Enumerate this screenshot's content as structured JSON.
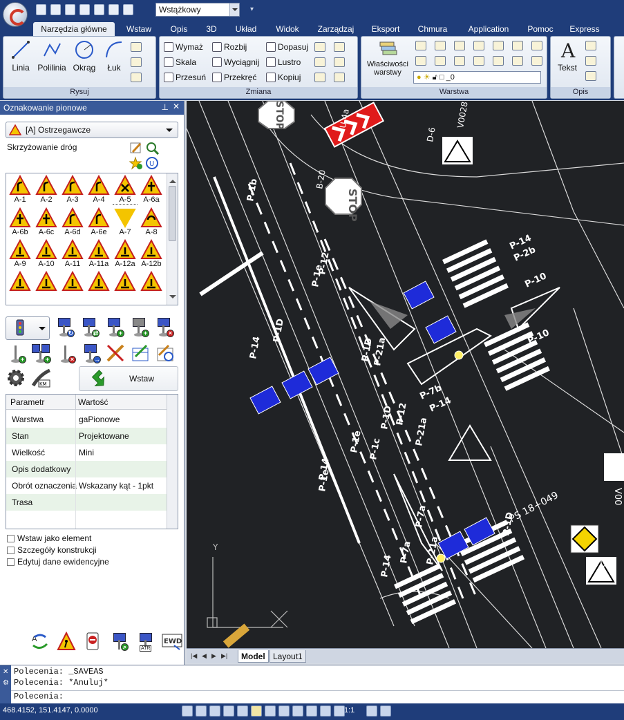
{
  "workspace": {
    "value": "Wstążkowy"
  },
  "ribbon_tabs": [
    {
      "label": "Narzędzia główne"
    },
    {
      "label": "Wstaw"
    },
    {
      "label": "Opis"
    },
    {
      "label": "3D"
    },
    {
      "label": "Układ"
    },
    {
      "label": "Widok"
    },
    {
      "label": "Zarządzaj"
    },
    {
      "label": "Eksport"
    },
    {
      "label": "Chmura"
    },
    {
      "label": "Application"
    },
    {
      "label": "Pomoc"
    },
    {
      "label": "Express"
    }
  ],
  "ribbon": {
    "draw": {
      "label": "Rysuj",
      "line": "Linia",
      "polyline": "Polilinia",
      "circle": "Okrąg",
      "arc": "Łuk"
    },
    "modify": {
      "label": "Zmiana",
      "stretch": "Wymaż",
      "explode": "Rozbij",
      "fit": "Dopasuj",
      "scale": "Skala",
      "extend": "Wyciągnij",
      "mirror": "Lustro",
      "move": "Przesuń",
      "rotate": "Przekręć",
      "copy": "Kopiuj"
    },
    "layer": {
      "label": "Warstwa",
      "properties": "Właściwości warstwy",
      "current": "_0"
    },
    "annotation": {
      "label": "Opis",
      "text": "Tekst"
    }
  },
  "panel": {
    "title": "Oznakowanie pionowe",
    "category": "[A] Ostrzegawcze",
    "search_text": "Skrzyżowanie dróg",
    "signs": [
      {
        "label": "A-1"
      },
      {
        "label": "A-2"
      },
      {
        "label": "A-3"
      },
      {
        "label": "A-4"
      },
      {
        "label": "A-5"
      },
      {
        "label": "A-6a"
      },
      {
        "label": "A-6b"
      },
      {
        "label": "A-6c"
      },
      {
        "label": "A-6d"
      },
      {
        "label": "A-6e"
      },
      {
        "label": "A-7"
      },
      {
        "label": "A-8"
      },
      {
        "label": "A-9"
      },
      {
        "label": "A-10"
      },
      {
        "label": "A-11"
      },
      {
        "label": "A-11a"
      },
      {
        "label": "A-12a"
      },
      {
        "label": "A-12b"
      },
      {
        "label": ""
      },
      {
        "label": ""
      },
      {
        "label": ""
      },
      {
        "label": ""
      },
      {
        "label": ""
      },
      {
        "label": ""
      }
    ],
    "insert_label": "Wstaw",
    "props_header": {
      "param": "Parametr",
      "value": "Wartość"
    },
    "props": [
      {
        "param": "Warstwa",
        "value": "gaPionowe"
      },
      {
        "param": "Stan",
        "value": "Projektowane"
      },
      {
        "param": "Wielkość",
        "value": "Mini"
      },
      {
        "param": "Opis dodatkowy",
        "value": ""
      },
      {
        "param": "Obrót oznaczenia",
        "value": "Wskazany kąt - 1pkt"
      },
      {
        "param": "Trasa",
        "value": ""
      }
    ],
    "checks": [
      {
        "label": "Wstaw jako element"
      },
      {
        "label": "Szczegóły konstrukcji"
      },
      {
        "label": "Edytuj dane ewidencyjne"
      }
    ]
  },
  "cad_labels": {
    "stop1": "STOP",
    "stop2": "STOP",
    "p1b": "P-1b",
    "p12": "P-12",
    "p14": "P-14",
    "p2b": "P-2b",
    "p10": "P-10",
    "p10b": "P-10",
    "p14b": "P-14",
    "p1d": "P-1D",
    "p1e": "P-1e",
    "p21a": "P-21a",
    "p7b": "P-7b",
    "p12b": "P-12",
    "p14c": "P-14",
    "p7a": "P-7a",
    "p1c": "P-1c",
    "chain": "PS 18+049",
    "d1": "D-1",
    "v002": "V00",
    "b20": "B-20",
    "a7": "A-7",
    "d6": "D-6",
    "u4a": "U-4a",
    "v0028": "V0028"
  },
  "layout_tabs": {
    "model": "Model",
    "layout1": "Layout1"
  },
  "command": {
    "line1": "Polecenia: _SAVEAS",
    "line2": "Polecenia: *Anuluj*",
    "prompt": "Polecenia:"
  },
  "status": {
    "coords": "468.4152, 151.4147, 0.0000",
    "scale": "1:1"
  }
}
